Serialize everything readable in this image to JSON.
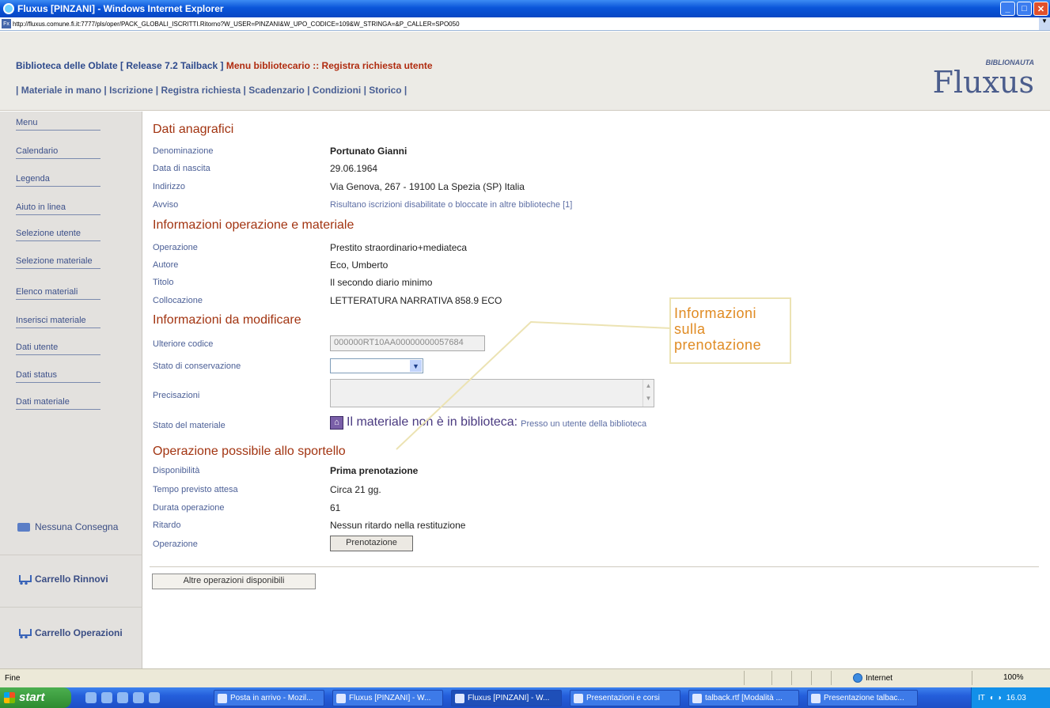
{
  "window": {
    "title": "Fluxus [PINZANI] - Windows Internet Explorer",
    "url": "http://fluxus.comune.fi.it:7777/pls/oper/PACK_GLOBALI_ISCRITTI.Ritorno?W_USER=PINZANI&W_UPO_CODICE=109&W_STRINGA=&P_CALLER=SPO050"
  },
  "header": {
    "library": "Biblioteca delle Oblate [ Release 7.2 Tailback ]",
    "menu_path": "Menu bibliotecario :: Registra richiesta utente",
    "nav": "| Materiale in mano | Iscrizione | Registra richiesta | Scadenzario | Condizioni | Storico |",
    "logo": "Fluxus",
    "logo_tag": "BIBLIONAUTA"
  },
  "sidebar": {
    "items": [
      {
        "label": "Menu"
      },
      {
        "label": "Calendario"
      },
      {
        "label": "Legenda"
      },
      {
        "label": "Aiuto in linea"
      },
      {
        "label": "Selezione utente"
      },
      {
        "label": "Selezione materiale"
      },
      {
        "label": "Elenco materiali"
      },
      {
        "label": "Inserisci materiale"
      },
      {
        "label": "Dati utente"
      },
      {
        "label": "Dati status"
      },
      {
        "label": "Dati materiale"
      }
    ],
    "consegna": "Nessuna Consegna",
    "carrello_rinnovi": "Carrello Rinnovi",
    "carrello_operazioni": "Carrello Operazioni"
  },
  "anagrafici": {
    "heading": "Dati anagrafici",
    "denominazione_label": "Denominazione",
    "denominazione": "Portunato Gianni",
    "nascita_label": "Data di nascita",
    "nascita": "29.06.1964",
    "indirizzo_label": "Indirizzo",
    "indirizzo": "Via Genova, 267 - 19100 La Spezia (SP) Italia",
    "avviso_label": "Avviso",
    "avviso": "Risultano iscrizioni disabilitate o bloccate in altre biblioteche [1]"
  },
  "operazione": {
    "heading": "Informazioni operazione e materiale",
    "operazione_label": "Operazione",
    "operazione": "Prestito straordinario+mediateca",
    "autore_label": "Autore",
    "autore": "Eco, Umberto",
    "titolo_label": "Titolo",
    "titolo": "Il secondo diario minimo",
    "collocazione_label": "Collocazione",
    "collocazione": "LETTERATURA NARRATIVA 858.9 ECO"
  },
  "modifica": {
    "heading": "Informazioni da modificare",
    "codice_label": "Ulteriore codice",
    "codice": "000000RT10AA00000000057684",
    "conservazione_label": "Stato di conservazione",
    "conservazione": "",
    "precisazioni_label": "Precisazioni",
    "precisazioni": "",
    "stato_label": "Stato del materiale",
    "stato_main": "Il materiale non è in biblioteca:",
    "stato_detail": "Presso un utente della biblioteca"
  },
  "sportello": {
    "heading": "Operazione possibile allo sportello",
    "disponibilita_label": "Disponibilità",
    "disponibilita": "Prima prenotazione",
    "attesa_label": "Tempo previsto attesa",
    "attesa": "Circa 21 gg.",
    "durata_label": "Durata operazione",
    "durata": "61",
    "ritardo_label": "Ritardo",
    "ritardo": "Nessun ritardo nella restituzione",
    "operazione_label": "Operazione",
    "prenotazione_button": "Prenotazione"
  },
  "altre_button": "Altre operazioni disponibili",
  "callout": "Informazioni sulla prenotazione",
  "statusbar": {
    "status": "Fine",
    "zone": "Internet",
    "zoom": "100%"
  },
  "taskbar": {
    "start": "start",
    "tasks": [
      "Posta in arrivo - Mozil...",
      "Fluxus [PINZANI] - W...",
      "Fluxus [PINZANI] - W...",
      "Presentazioni e corsi",
      "talback.rtf [Modalità ...",
      "Presentazione talbac..."
    ],
    "lang": "IT",
    "clock": "16.03"
  }
}
